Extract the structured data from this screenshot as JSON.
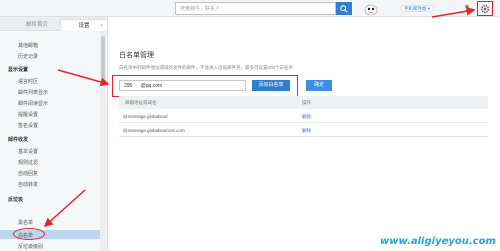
{
  "header": {
    "search_placeholder": "搜索邮件，联系人",
    "phone_link": "手机邮件端 ▾"
  },
  "tabs": [
    {
      "label": "邮件首页"
    },
    {
      "label": "设置",
      "close": "×"
    }
  ],
  "sidebar": {
    "items": [
      {
        "label": "其他邮箱"
      },
      {
        "label": "历史记录"
      },
      {
        "label": "显示设置",
        "section": true
      },
      {
        "label": "语言时区"
      },
      {
        "label": "邮件列表显示"
      },
      {
        "label": "邮件阅读显示"
      },
      {
        "label": "提醒设置"
      },
      {
        "label": "签名设置"
      },
      {
        "label": "邮件收发",
        "section": true
      },
      {
        "label": "基本设置"
      },
      {
        "label": "规则过滤"
      },
      {
        "label": "自动回复"
      },
      {
        "label": "自动转发"
      },
      {
        "label": "反垃圾",
        "section": true
      },
      {
        "label": "黑名单"
      },
      {
        "label": "白名单"
      },
      {
        "label": "反垃圾级别"
      }
    ]
  },
  "main": {
    "title": "白名单管理",
    "description": "白名单中的邮件地址或域的发件的邮件，不会进入垃圾邮件夹，最多可设置500个白名单",
    "input_value": "295      @qq.com",
    "add_button": "添加白名单",
    "done_button": "确定",
    "table": {
      "headers": [
        "邮箱地址或域名",
        "操作"
      ],
      "rows": [
        {
          "address": "@message.globalsour",
          "action": "删除"
        },
        {
          "address": "@message.globalsources.com",
          "action": "删除"
        }
      ]
    }
  },
  "watermark": "www.aligiyeyou.com",
  "colors": {
    "accent": "#2f7fcd",
    "highlight": "#e3262b",
    "sidebar_active": "#bed6ef"
  }
}
